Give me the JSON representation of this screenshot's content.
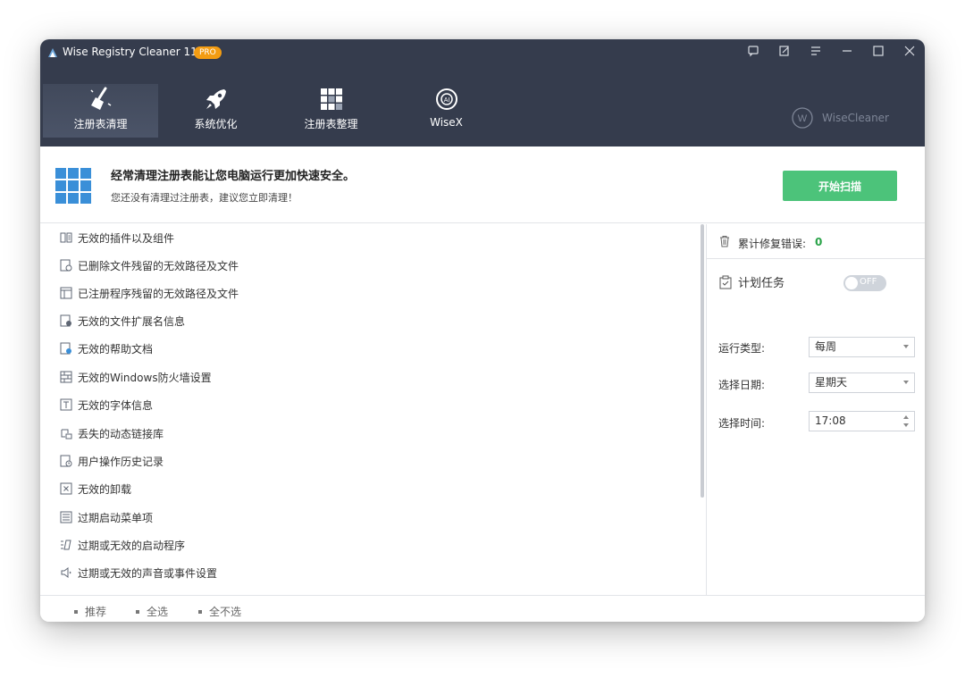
{
  "app": {
    "title": "Wise Registry Cleaner 11",
    "badge": "PRO"
  },
  "nav": [
    {
      "label": "注册表清理",
      "icon": "broom-icon",
      "active": true
    },
    {
      "label": "系统优化",
      "icon": "rocket-icon",
      "active": false
    },
    {
      "label": "注册表整理",
      "icon": "grid-blocks-icon",
      "active": false
    },
    {
      "label": "WiseX",
      "icon": "ai-icon",
      "active": false
    }
  ],
  "brand": {
    "label": "WiseCleaner"
  },
  "banner": {
    "title": "经常清理注册表能让您电脑运行更加快速安全。",
    "subtitle": "您还没有清理过注册表，建议您立即清理！",
    "scan_button": "开始扫描"
  },
  "items": [
    {
      "label": "无效的插件以及组件",
      "icon": "plugin-icon"
    },
    {
      "label": "已删除文件残留的无效路径及文件",
      "icon": "deleted-file-icon"
    },
    {
      "label": "已注册程序残留的无效路径及文件",
      "icon": "program-file-icon"
    },
    {
      "label": "无效的文件扩展名信息",
      "icon": "file-extension-icon"
    },
    {
      "label": "无效的帮助文档",
      "icon": "help-doc-icon"
    },
    {
      "label": "无效的Windows防火墙设置",
      "icon": "firewall-icon"
    },
    {
      "label": "无效的字体信息",
      "icon": "font-icon"
    },
    {
      "label": "丢失的动态链接库",
      "icon": "dll-icon"
    },
    {
      "label": "用户操作历史记录",
      "icon": "history-icon"
    },
    {
      "label": "无效的卸载",
      "icon": "uninstall-icon"
    },
    {
      "label": "过期启动菜单项",
      "icon": "start-menu-icon"
    },
    {
      "label": "过期或无效的启动程序",
      "icon": "startup-icon"
    },
    {
      "label": "过期或无效的声音或事件设置",
      "icon": "sound-icon"
    }
  ],
  "stats": {
    "label": "累计修复错误:",
    "value": "0"
  },
  "schedule": {
    "label": "计划任务",
    "toggle_text": "OFF",
    "run_type_label": "运行类型:",
    "run_type_value": "每周",
    "date_label": "选择日期:",
    "date_value": "星期天",
    "time_label": "选择时间:",
    "time_value": "17:08"
  },
  "footer": {
    "recommend": "推荐",
    "select_all": "全选",
    "select_none": "全不选"
  }
}
